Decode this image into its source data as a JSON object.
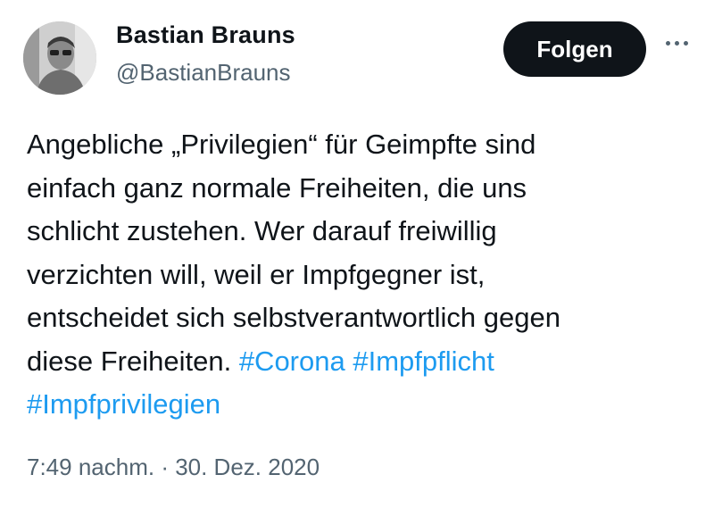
{
  "author": {
    "name": "Bastian Brauns",
    "handle": "@BastianBrauns",
    "avatar_icon": "profile-photo"
  },
  "follow_label": "Folgen",
  "more_icon": "more-horizontal-icon",
  "tweet": {
    "lines": [
      "Angebliche „Privilegien“ für Geimpfte sind",
      "einfach ganz normale Freiheiten, die uns",
      "schlicht zustehen. Wer darauf freiwillig",
      "verzichten will, weil er Impfgegner ist,",
      "entscheidet sich selbstverantwortlich gegen",
      "diese Freiheiten."
    ],
    "hashtags": [
      "#Corona",
      "#Impfpflicht",
      "#Impfprivilegien"
    ]
  },
  "timestamp": "7:49 nachm. · 30. Dez. 2020",
  "colors": {
    "text": "#0f1419",
    "secondary": "#536471",
    "link": "#1d9bf0",
    "button_bg": "#0f1419"
  }
}
